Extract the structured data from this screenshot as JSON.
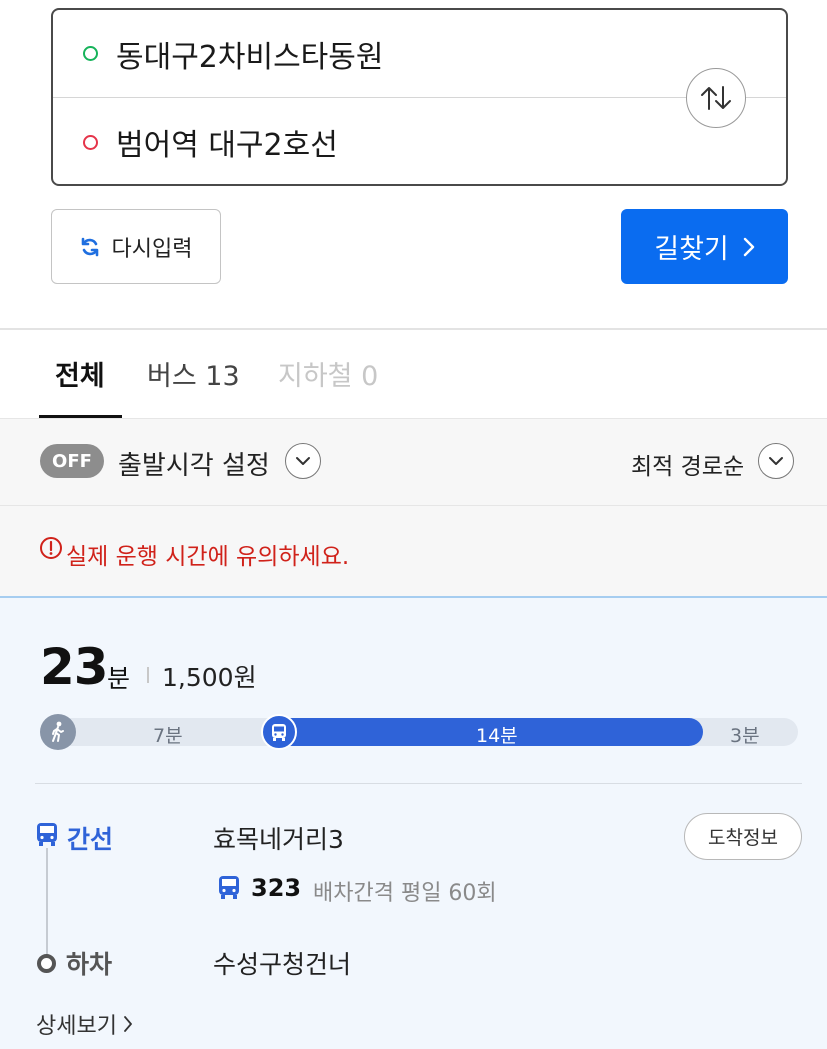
{
  "route": {
    "origin": "동대구2차비스타동원",
    "destination": "범어역 대구2호선"
  },
  "actions": {
    "reset_label": "다시입력",
    "search_label": "길찾기"
  },
  "tabs": [
    {
      "label": "전체"
    },
    {
      "label": "버스 13"
    },
    {
      "label": "지하철 0"
    }
  ],
  "options": {
    "departure_toggle": "OFF",
    "departure_label": "출발시각 설정",
    "sort_label": "최적 경로순"
  },
  "notice": "실제 운행 시간에 유의하세요.",
  "result": {
    "duration": "23",
    "duration_unit": "분",
    "fare": "1,500원",
    "segments": {
      "walk": "7분",
      "bus": "14분",
      "end": "3분"
    },
    "segment_minutes": {
      "walk": 7,
      "bus": 14,
      "end": 3
    },
    "steps": {
      "board_type": "간선",
      "board_stop": "효목네거리3",
      "arrival_info_label": "도착정보",
      "bus_number": "323",
      "interval": "배차간격 평일 60회",
      "alight_type": "하차",
      "alight_stop": "수성구청건너"
    },
    "detail_label": "상세보기"
  },
  "colors": {
    "primary": "#0a6cf0",
    "bus_blue": "#2f63d8",
    "notice_red": "#d0221a",
    "origin_dot": "#16b35a",
    "dest_dot": "#e5344a"
  }
}
